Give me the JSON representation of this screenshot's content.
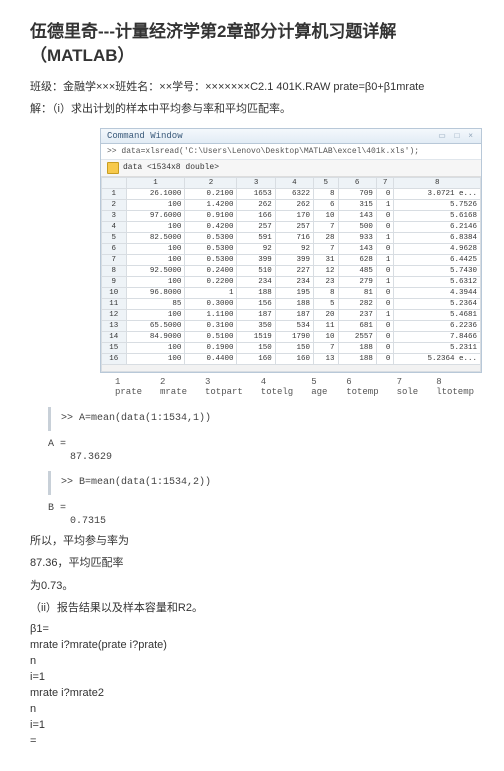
{
  "title": "伍德里奇---计量经济学第2章部分计算机习题详解（MATLAB）",
  "meta": "班级：金融学×××班姓名：××学号：×××××××C2.1 401K.RAW prate=β0+β1mrate",
  "sol_head": "解：（i）求出计划的样本中平均参与率和平均匹配率。",
  "panel_label": "Command Window",
  "panel_cmd": ">> data=xlsread('C:\\Users\\Lenovo\\Desktop\\MATLAB\\excel\\401k.xls');",
  "var_label": "data <1534x8 double>",
  "win_ctrl": "▭ □ ×",
  "chart_data": {
    "type": "table",
    "col_headers": [
      "1",
      "2",
      "3",
      "4",
      "5",
      "6",
      "7",
      "8"
    ],
    "row_headers": [
      "1",
      "2",
      "3",
      "4",
      "5",
      "6",
      "7",
      "8",
      "9",
      "10",
      "11",
      "12",
      "13",
      "14",
      "15",
      "16"
    ],
    "rows": [
      [
        "26.1000",
        "0.2100",
        "1653",
        "6322",
        "8",
        "709",
        "0",
        "3.0721 e..."
      ],
      [
        "100",
        "1.4200",
        "262",
        "262",
        "6",
        "315",
        "1",
        "5.7526"
      ],
      [
        "97.6000",
        "0.9100",
        "166",
        "170",
        "10",
        "143",
        "0",
        "5.6168"
      ],
      [
        "100",
        "0.4200",
        "257",
        "257",
        "7",
        "500",
        "0",
        "6.2146"
      ],
      [
        "82.5000",
        "0.5300",
        "591",
        "716",
        "28",
        "933",
        "1",
        "6.8384"
      ],
      [
        "100",
        "0.5300",
        "92",
        "92",
        "7",
        "143",
        "0",
        "4.9628"
      ],
      [
        "100",
        "0.5300",
        "399",
        "399",
        "31",
        "628",
        "1",
        "6.4425"
      ],
      [
        "92.5000",
        "0.2400",
        "510",
        "227",
        "12",
        "485",
        "0",
        "5.7430"
      ],
      [
        "100",
        "0.2200",
        "234",
        "234",
        "23",
        "279",
        "1",
        "5.6312"
      ],
      [
        "96.8000",
        "1",
        "188",
        "195",
        "8",
        "81",
        "0",
        "4.3944"
      ],
      [
        "85",
        "0.3000",
        "156",
        "188",
        "5",
        "282",
        "0",
        "5.2364"
      ],
      [
        "100",
        "1.1100",
        "187",
        "187",
        "20",
        "237",
        "1",
        "5.4681"
      ],
      [
        "65.5000",
        "0.3100",
        "350",
        "534",
        "11",
        "681",
        "0",
        "6.2236"
      ],
      [
        "84.9000",
        "0.5100",
        "1519",
        "1790",
        "10",
        "2557",
        "0",
        "7.8466"
      ],
      [
        "100",
        "0.1900",
        "150",
        "150",
        "7",
        "188",
        "0",
        "5.2311"
      ],
      [
        "100",
        "0.4400",
        "160",
        "160",
        "13",
        "188",
        "0",
        "5.2364 e..."
      ]
    ],
    "col_names": [
      "1 prate",
      "2 mrate",
      "3 totpart",
      "4 totelg",
      "5 age",
      "6 totemp",
      "7 sole",
      "8 ltotemp"
    ]
  },
  "code1": ">> A=mean(data(1:1534,1))",
  "res1a": "A =",
  "res1b": "87.3629",
  "code2": ">> B=mean(data(1:1534,2))",
  "res2a": "B =",
  "res2b": "0.7315",
  "txt1": "所以，平均参与率为",
  "txt2": "87.36，平均匹配率",
  "txt3": "为0.73。",
  "txt4": "（ii）报告结果以及样本容量和R2。",
  "m1": "β1=",
  "m2": "mrate i?mrate(prate i?prate)",
  "m3": "n",
  "m4": "i=1",
  "m5": "mrate i?mrate2",
  "m6": "n",
  "m7": "i=1",
  "m8": "="
}
